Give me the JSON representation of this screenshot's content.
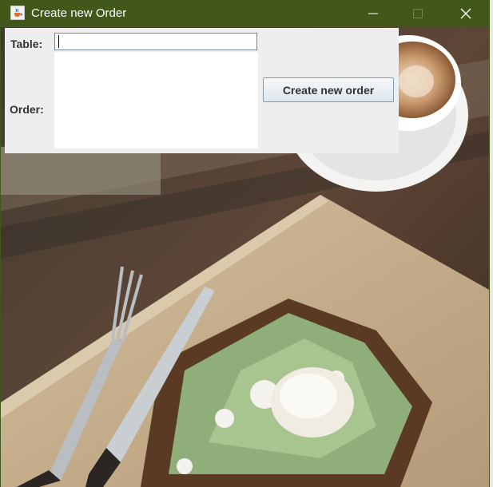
{
  "window": {
    "title": "Create new Order",
    "icon": "java-cup-icon"
  },
  "form": {
    "table_label": "Table:",
    "table_value": "",
    "order_label": "Order:",
    "order_value": "",
    "create_button_label": "Create new order"
  },
  "colors": {
    "titlebar": "#42581a",
    "panel": "#eeeeee",
    "button_border": "#7f9db9"
  }
}
